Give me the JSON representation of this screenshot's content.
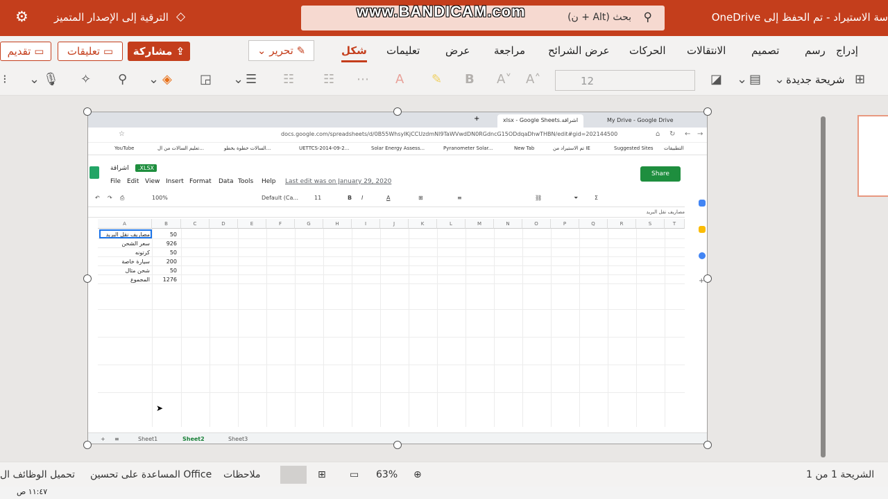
{
  "titlebar": {
    "doc_title": "سة الاستيراد - تم الحفظ إلى OneDrive",
    "search_placeholder": "بحث (Alt + ن)",
    "upgrade": "الترقية إلى الإصدار المتميز",
    "watermark": "www.BANDICAM.com"
  },
  "ribbon": {
    "tabs": [
      "إدراج",
      "رسم",
      "تصميم",
      "الانتقالات",
      "الحركات",
      "عرض الشرائح",
      "مراجعة",
      "عرض",
      "تعليمات",
      "شكل"
    ],
    "active_tab": "شكل",
    "share": "مشاركة",
    "comments": "تعليقات",
    "present": "تقديم",
    "edit_mode": "تحرير",
    "font_size": "12",
    "new_slide": "شريحة جديدة"
  },
  "browser": {
    "tab1": "My Drive - Google Drive",
    "tab2": "xlsx - Google Sheets.اشراقة",
    "url": "docs.google.com/spreadsheets/d/0B55WhsyIKjCCUzdmNl9TaWVwdDN0RGdncG15ODdqaDhwTHBN/edit#gid=202144500",
    "bookmarks": [
      "التطبيقات",
      "Suggested Sites",
      "تم الاستيراد من IE",
      "New Tab",
      "Pyranometer Solar...",
      "Solar Energy Assess...",
      "UETTCS-2014-09-2...",
      "السالات خطوة بخطو...",
      "تعليم السالات من ال...",
      "YouTube"
    ]
  },
  "sheets": {
    "name": "اشراقة",
    "badge": ".XLSX",
    "menu": [
      "File",
      "Edit",
      "View",
      "Insert",
      "Format",
      "Data",
      "Tools",
      "Help"
    ],
    "last_edit": "Last edit was on January 29, 2020",
    "share": "Share",
    "zoom": "100%",
    "font": "Default (Ca...",
    "size": "11",
    "formula_text": "مصاريف نقل البريد",
    "columns": [
      "A",
      "B",
      "C",
      "D",
      "E",
      "F",
      "G",
      "H",
      "I",
      "J",
      "K",
      "L",
      "M",
      "N",
      "O",
      "P",
      "Q",
      "R",
      "S",
      "T"
    ],
    "rows": [
      {
        "label": "مصاريف نقل البريد",
        "value": "50"
      },
      {
        "label": "سعر الشحن",
        "value": "926"
      },
      {
        "label": "كرتونه",
        "value": "50"
      },
      {
        "label": "سيارة خاصة",
        "value": "200"
      },
      {
        "label": "شحن مثال",
        "value": "50"
      },
      {
        "label": "المجموع",
        "value": "1276"
      }
    ],
    "sheet_tabs": [
      "Sheet1",
      "Sheet2",
      "Sheet3"
    ],
    "active_sheet": "Sheet2"
  },
  "statusbar": {
    "slide_info": "الشريحة 1 من 1",
    "zoom": "63%",
    "notes": "ملاحظات",
    "help_improve": "المساعدة على تحسين Office",
    "addins": "تحميل الوظائف ال"
  },
  "taskbar": {
    "time": "١١:٤٧ ص"
  },
  "colors": {
    "accent": "#c43e1c",
    "sheets_green": "#1e8e3e"
  }
}
